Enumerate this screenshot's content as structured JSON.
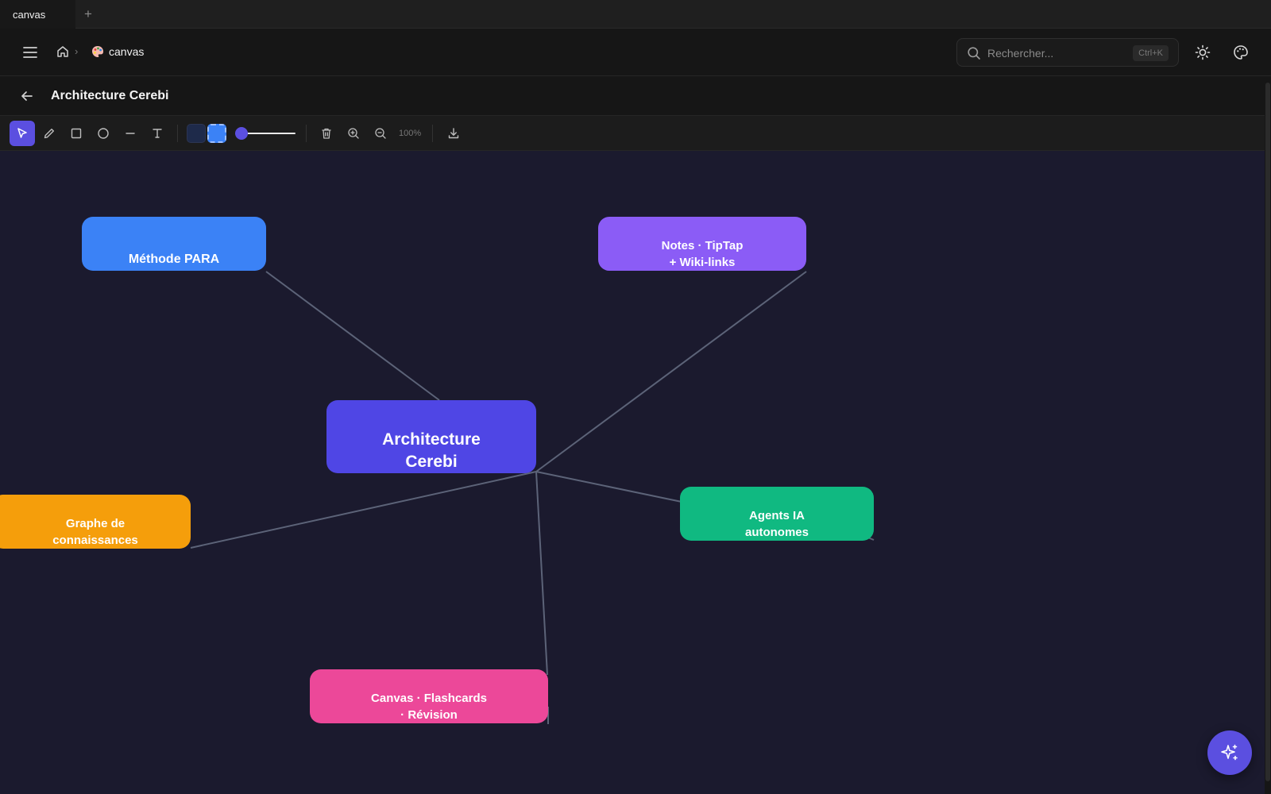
{
  "browser": {
    "tab_title": "canvas",
    "new_tab_label": "+"
  },
  "header": {
    "breadcrumb": {
      "separator": "›",
      "current_label": "canvas",
      "current_icon": "palette-emoji"
    },
    "search": {
      "placeholder": "Rechercher...",
      "shortcut": "Ctrl+K"
    },
    "icons": [
      "menu-icon",
      "home-icon",
      "search-icon",
      "sun-icon",
      "palette-icon"
    ]
  },
  "canvas_page": {
    "title": "Architecture Cerebi",
    "toolbar": {
      "tools": [
        "select",
        "pencil",
        "rectangle",
        "ellipse",
        "line",
        "text"
      ],
      "active_tool": "select",
      "stroke_color": "#1e2a4a",
      "fill_color": "#3b82f6",
      "stroke_width_fraction": 0.05,
      "zoom_level": "100%",
      "actions": [
        "delete",
        "zoom-in",
        "zoom-out",
        "export"
      ]
    }
  },
  "mindmap": {
    "center": {
      "label_line1": "Architecture",
      "label_line2": "Cerebi",
      "color": "#4f46e5"
    },
    "nodes": [
      {
        "id": "para",
        "label_line1": "",
        "label_line2": "Méthode PARA",
        "color": "#3b82f6"
      },
      {
        "id": "notes",
        "label_line1": "Notes · TipTap",
        "label_line2": "+ Wiki-links",
        "color": "#8b5cf6"
      },
      {
        "id": "graphe",
        "label_line1": "Graphe de",
        "label_line2": "connaissances",
        "color": "#f59e0b"
      },
      {
        "id": "agents",
        "label_line1": "Agents IA",
        "label_line2": "autonomes",
        "color": "#10b981"
      },
      {
        "id": "canvas",
        "label_line1": "Canvas · Flashcards",
        "label_line2": "· Révision",
        "color": "#ec4899"
      }
    ],
    "edge_color": "#5c6378"
  },
  "assistant": {
    "icon": "sparkles-icon",
    "color": "#5b4fe0"
  }
}
